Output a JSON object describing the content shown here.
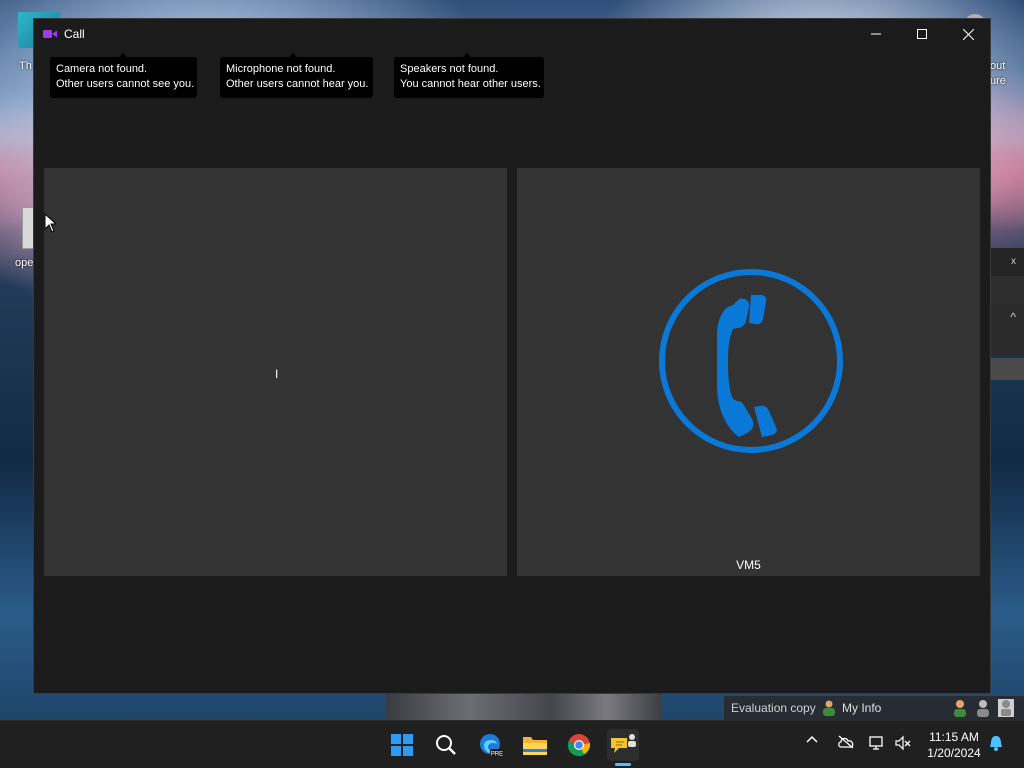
{
  "desktop": {
    "left_fragments": [
      "Th",
      "ope"
    ],
    "right_fragments": [
      "out",
      "ure"
    ]
  },
  "background_window": {
    "close_glyph": "x",
    "chevron_glyph": "^"
  },
  "call_window": {
    "title": "Call",
    "title_icon": "video-camera-icon",
    "accent_color": "#8a2be2",
    "controls": {
      "minimize": "–",
      "maximize": "☐",
      "close": "✕"
    },
    "toasts": [
      {
        "line1": "Camera not found.",
        "line2": "Other users cannot see you."
      },
      {
        "line1": "Microphone not found.",
        "line2": "Other users cannot hear you."
      },
      {
        "line1": "Speakers not found.",
        "line2": "You cannot hear other users."
      }
    ],
    "local_panel": {
      "text_cursor": "I"
    },
    "remote_panel": {
      "name": "VM5",
      "emblem": "phone-icon",
      "emblem_color": "#0a78d7"
    }
  },
  "eval_strip": {
    "text": "Evaluation copy",
    "my_info": "My Info"
  },
  "taskbar": {
    "icons": [
      "windows-start-icon",
      "search-icon",
      "edge-beta-icon",
      "file-explorer-icon",
      "chrome-icon",
      "chat-app-icon"
    ],
    "edge_badge": "PRE",
    "tray": {
      "overflow": "^",
      "time": "11:15 AM",
      "date": "1/20/2024"
    }
  },
  "colors": {
    "window_bg": "#1b1b1b",
    "panel_bg": "#333333",
    "toast_bg": "#000000",
    "taskbar_bg": "#202020",
    "indicator": "#4cc2ff"
  }
}
